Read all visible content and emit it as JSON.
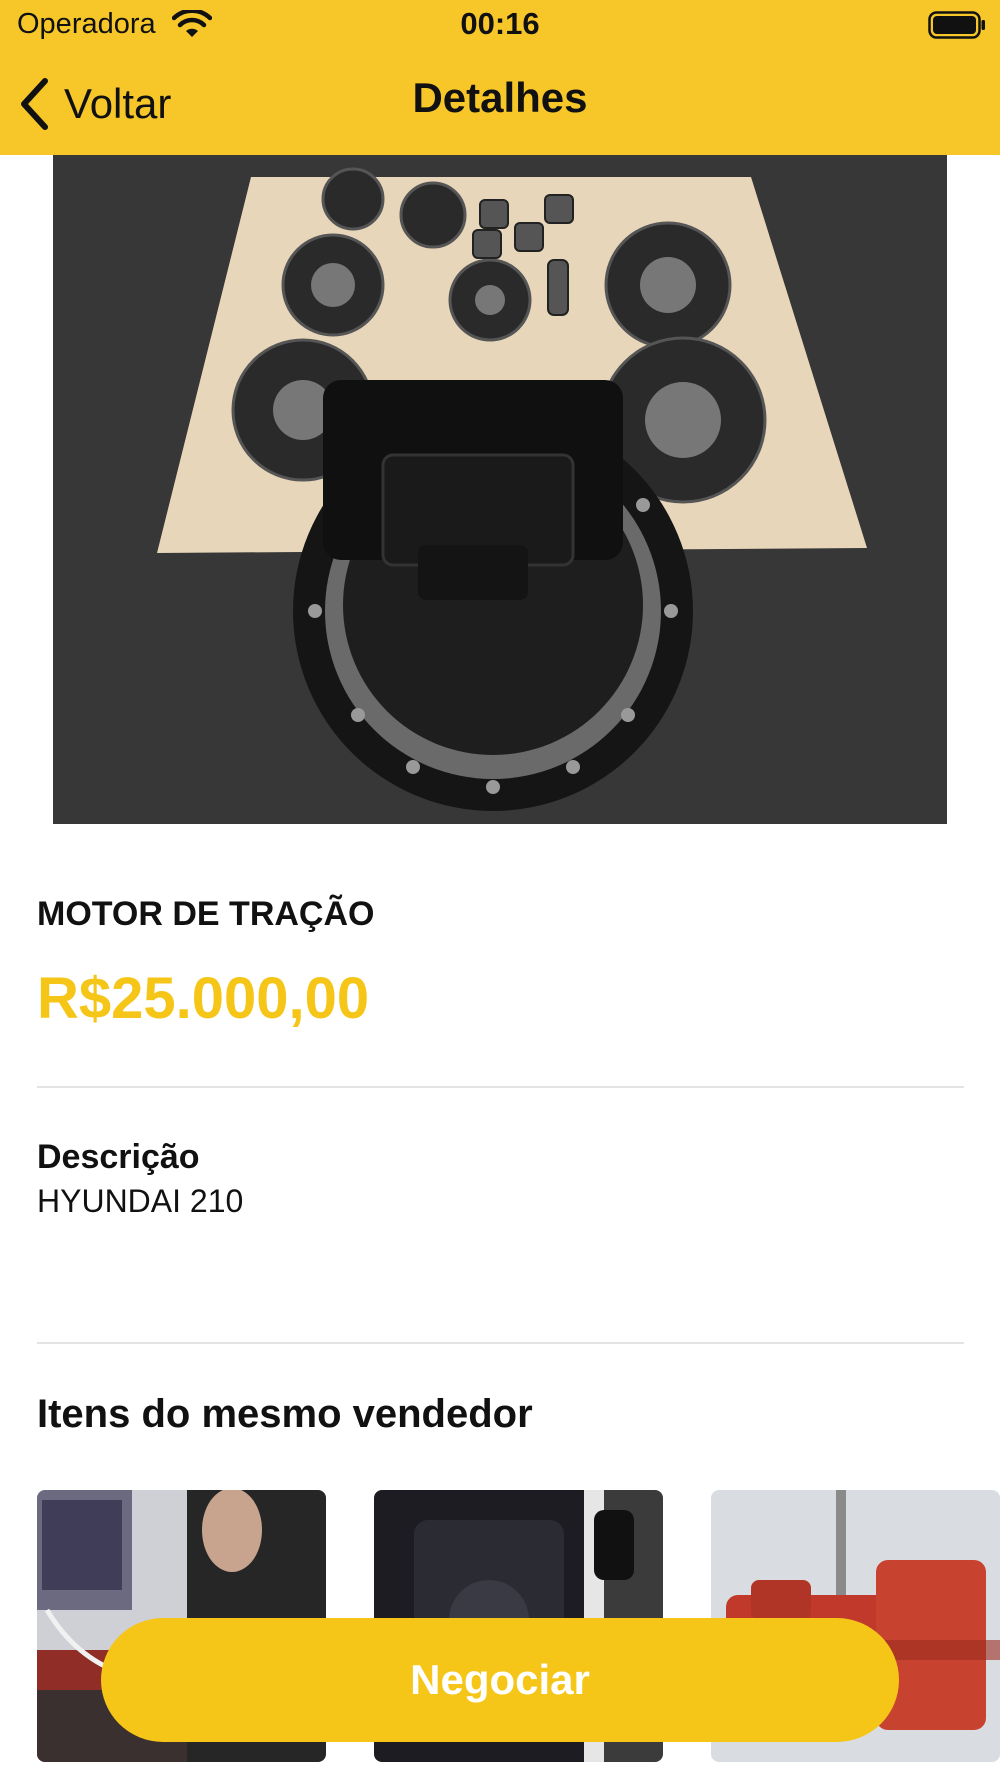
{
  "status_bar": {
    "carrier": "Operadora",
    "time": "00:16"
  },
  "nav": {
    "back_label": "Voltar",
    "title": "Detalhes"
  },
  "product": {
    "name": "MOTOR DE TRAÇÃO",
    "price": "R$25.000,00",
    "description_label": "Descrição",
    "description": "HYUNDAI 210"
  },
  "seller_items": {
    "heading": "Itens do mesmo vendedor"
  },
  "cta": {
    "label": "Negociar"
  },
  "colors": {
    "brand_yellow": "#F7C72A",
    "price_yellow": "#F5C518"
  },
  "icons": [
    "wifi-icon",
    "battery-icon",
    "chevron-left-icon"
  ]
}
